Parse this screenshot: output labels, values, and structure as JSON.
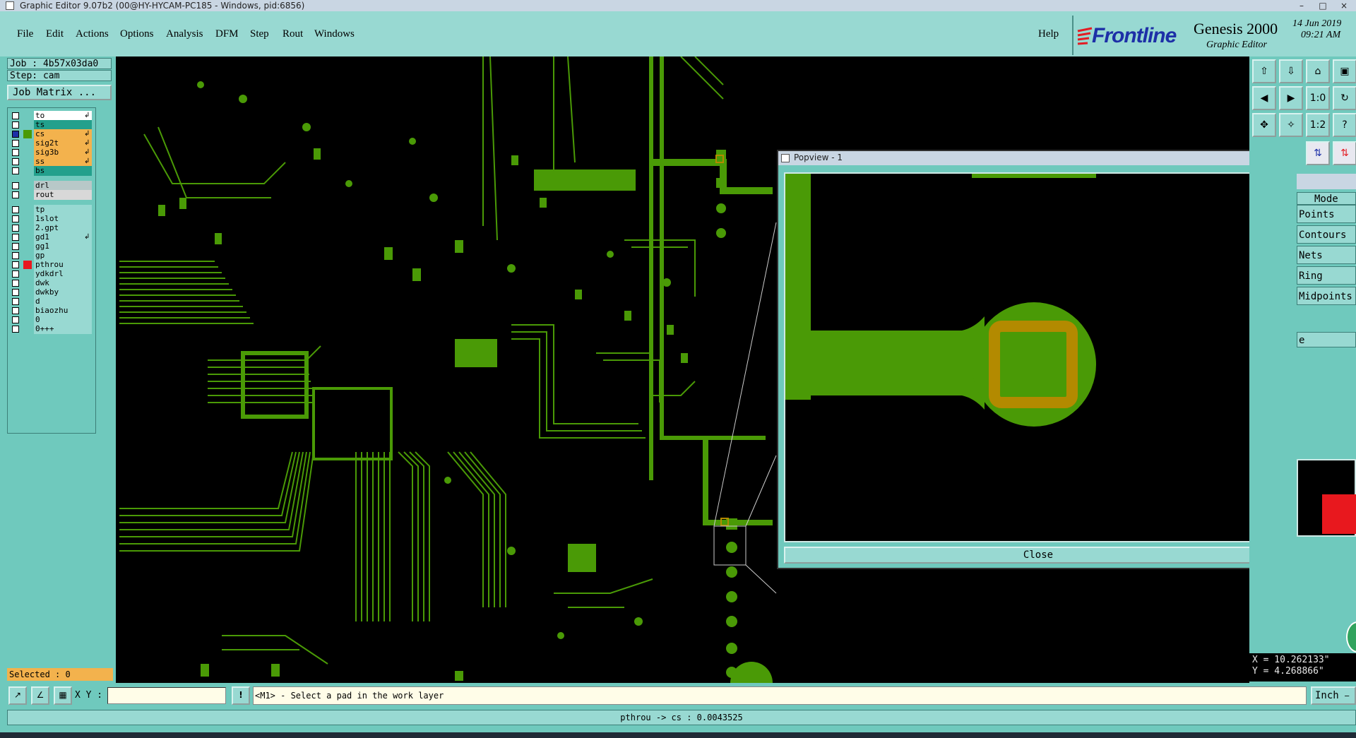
{
  "window": {
    "title": "Graphic Editor 9.07b2 (00@HY-HYCAM-PC185 - Windows, pid:6856)"
  },
  "menu": [
    "File",
    "Edit",
    "Actions",
    "Options",
    "Analysis",
    "DFM",
    "Step",
    "Rout",
    "Windows"
  ],
  "help_label": "Help",
  "brand": {
    "logo": "Frontline",
    "product": "Genesis 2000",
    "subtitle": "Graphic Editor",
    "date": "14 Jun 2019",
    "time": "09:21 AM"
  },
  "job": {
    "label": "Job : 4b57x03da0",
    "step": "Step: cam",
    "matrix_button": "Job Matrix ..."
  },
  "layers": [
    {
      "name": "to",
      "color": "#ffffff",
      "arrow": true
    },
    {
      "name": "ts",
      "color": "#23a08c",
      "arrow": false
    },
    {
      "name": "cs",
      "color": "#f3b24d",
      "arrow": true,
      "work": true
    },
    {
      "name": "sig2t",
      "color": "#f3b24d",
      "arrow": true
    },
    {
      "name": "sig3b",
      "color": "#f3b24d",
      "arrow": true
    },
    {
      "name": "ss",
      "color": "#f3b24d",
      "arrow": true
    },
    {
      "name": "bs",
      "color": "#23a08c",
      "arrow": false
    },
    {
      "name": "drl",
      "color": "#b8c8c8",
      "arrow": false
    },
    {
      "name": "rout",
      "color": "#d8d8d8",
      "arrow": false
    },
    {
      "name": "tp",
      "color": "#98d9d2",
      "arrow": false
    },
    {
      "name": "1slot",
      "color": "#98d9d2",
      "arrow": false
    },
    {
      "name": "2.gpt",
      "color": "#98d9d2",
      "arrow": false
    },
    {
      "name": "gd1",
      "color": "#98d9d2",
      "arrow": true
    },
    {
      "name": "gg1",
      "color": "#98d9d2",
      "arrow": false
    },
    {
      "name": "gp",
      "color": "#98d9d2",
      "arrow": false
    },
    {
      "name": "pthrou",
      "color": "#98d9d2",
      "arrow": false,
      "marker": "#e8181e"
    },
    {
      "name": "ydkdrl",
      "color": "#98d9d2",
      "arrow": false
    },
    {
      "name": "dwk",
      "color": "#98d9d2",
      "arrow": false
    },
    {
      "name": "dwkby",
      "color": "#98d9d2",
      "arrow": false
    },
    {
      "name": "d",
      "color": "#98d9d2",
      "arrow": false
    },
    {
      "name": "biaozhu",
      "color": "#98d9d2",
      "arrow": false
    },
    {
      "name": "0",
      "color": "#98d9d2",
      "arrow": false
    },
    {
      "name": "0+++",
      "color": "#98d9d2",
      "arrow": false
    }
  ],
  "selected_label": "Selected : 0",
  "popview": {
    "title": "Popview - 1",
    "close_label": "Close"
  },
  "snap_menu": {
    "title": "Mode",
    "items": [
      "Points",
      "Contours",
      "Nets",
      "Ring",
      "Midpoints"
    ],
    "partial": "e"
  },
  "toolbar_icons": [
    "zoom-home-icon",
    "zoom-in-icon",
    "zoom-out-icon",
    "fit-icon",
    "pan-left-icon",
    "pan-right-icon",
    "zoom-ratio-icon",
    "query-icon",
    "measure-icon",
    "zoom-area-icon",
    "scale-1-2-icon",
    "help-icon"
  ],
  "coords": {
    "x": "X = 10.262133\"",
    "y": "Y = 4.268866\""
  },
  "bottom": {
    "xy_label": "X Y :",
    "xy_value": "",
    "prompt": "<M1> - Select a pad in the work layer",
    "units": "Inch"
  },
  "status": {
    "text": "pthrou -> cs : 0.0043525"
  },
  "colors": {
    "copper": "#4a9a06",
    "pad_ring": "#b38a00",
    "panel": "#6fc9bd",
    "panel_light": "#98d9d2",
    "work_layer": "#f3b24d"
  }
}
